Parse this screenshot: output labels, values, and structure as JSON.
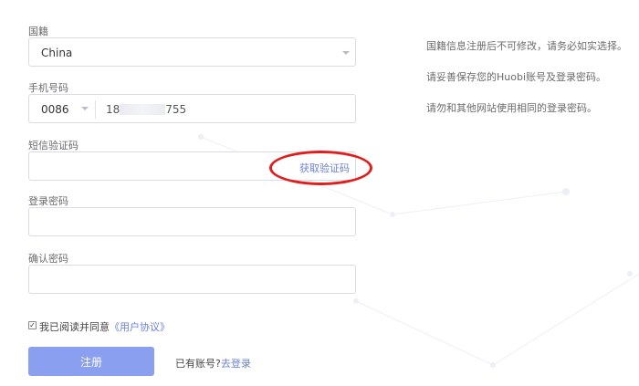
{
  "nationality": {
    "label": "国籍",
    "selected": "China"
  },
  "phone": {
    "label": "手机号码",
    "country_code": "0086",
    "number_prefix": "18",
    "number_suffix": "755"
  },
  "sms": {
    "label": "短信验证码",
    "value": "",
    "get_code_link": "获取验证码"
  },
  "login_password": {
    "label": "登录密码",
    "value": ""
  },
  "confirm_password": {
    "label": "确认密码",
    "value": ""
  },
  "info": {
    "line1": "国籍信息注册后不可修改，请务必如实选择。",
    "line2": "请妥善保存您的Huobi账号及登录密码。",
    "line3": "请勿和其他网站使用相同的登录密码。"
  },
  "agreement": {
    "checked": true,
    "text": "我已阅读并同意",
    "link": "《用户协议》"
  },
  "register_button": "注册",
  "login_prompt": {
    "text": "已有账号?",
    "link": "去登录"
  },
  "colors": {
    "accent": "#6b82d6",
    "button": "#8a9ff0",
    "highlight_ellipse": "#e11d1d"
  }
}
